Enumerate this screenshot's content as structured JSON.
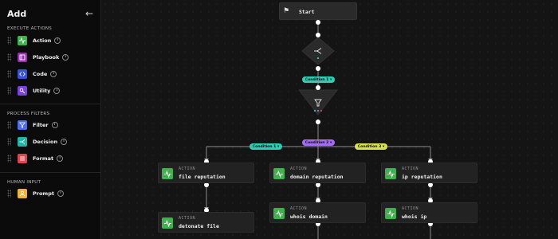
{
  "sidebar": {
    "title": "Add",
    "sections": {
      "execute": "EXECUTE ACTIONS",
      "filters": "PROCESS FILTERS",
      "human": "HUMAN INPUT"
    },
    "items": [
      {
        "label": "Action",
        "icon": "action-icon",
        "color": "#3cb44b"
      },
      {
        "label": "Playbook",
        "icon": "playbook-icon",
        "color": "#9b2fae"
      },
      {
        "label": "Code",
        "icon": "code-icon",
        "color": "#3a52d6"
      },
      {
        "label": "Utility",
        "icon": "utility-icon",
        "color": "#7b3fe4"
      },
      {
        "label": "Filter",
        "icon": "filter-icon",
        "color": "#4f6cf0"
      },
      {
        "label": "Decision",
        "icon": "decision-icon",
        "color": "#1fb5a8"
      },
      {
        "label": "Format",
        "icon": "format-icon",
        "color": "#e0444e"
      },
      {
        "label": "Prompt",
        "icon": "prompt-icon",
        "color": "#f2b233"
      }
    ]
  },
  "canvas": {
    "start": "Start",
    "conditions": {
      "decision_label": "Condition 1",
      "c1": "Condition 1",
      "c2": "Condition 2",
      "c3": "Condition 3"
    },
    "actions": [
      {
        "kind": "ACTION",
        "title": "file reputation"
      },
      {
        "kind": "ACTION",
        "title": "domain reputation"
      },
      {
        "kind": "ACTION",
        "title": "ip reputation"
      },
      {
        "kind": "ACTION",
        "title": "detonate file"
      },
      {
        "kind": "ACTION",
        "title": "whois domain"
      },
      {
        "kind": "ACTION",
        "title": "whois ip"
      }
    ]
  },
  "colors": {
    "condition_teal": "#2bd0b4",
    "condition_purple": "#a56bf3",
    "condition_yellow": "#d6e34a",
    "action_green": "#3cb44b"
  }
}
